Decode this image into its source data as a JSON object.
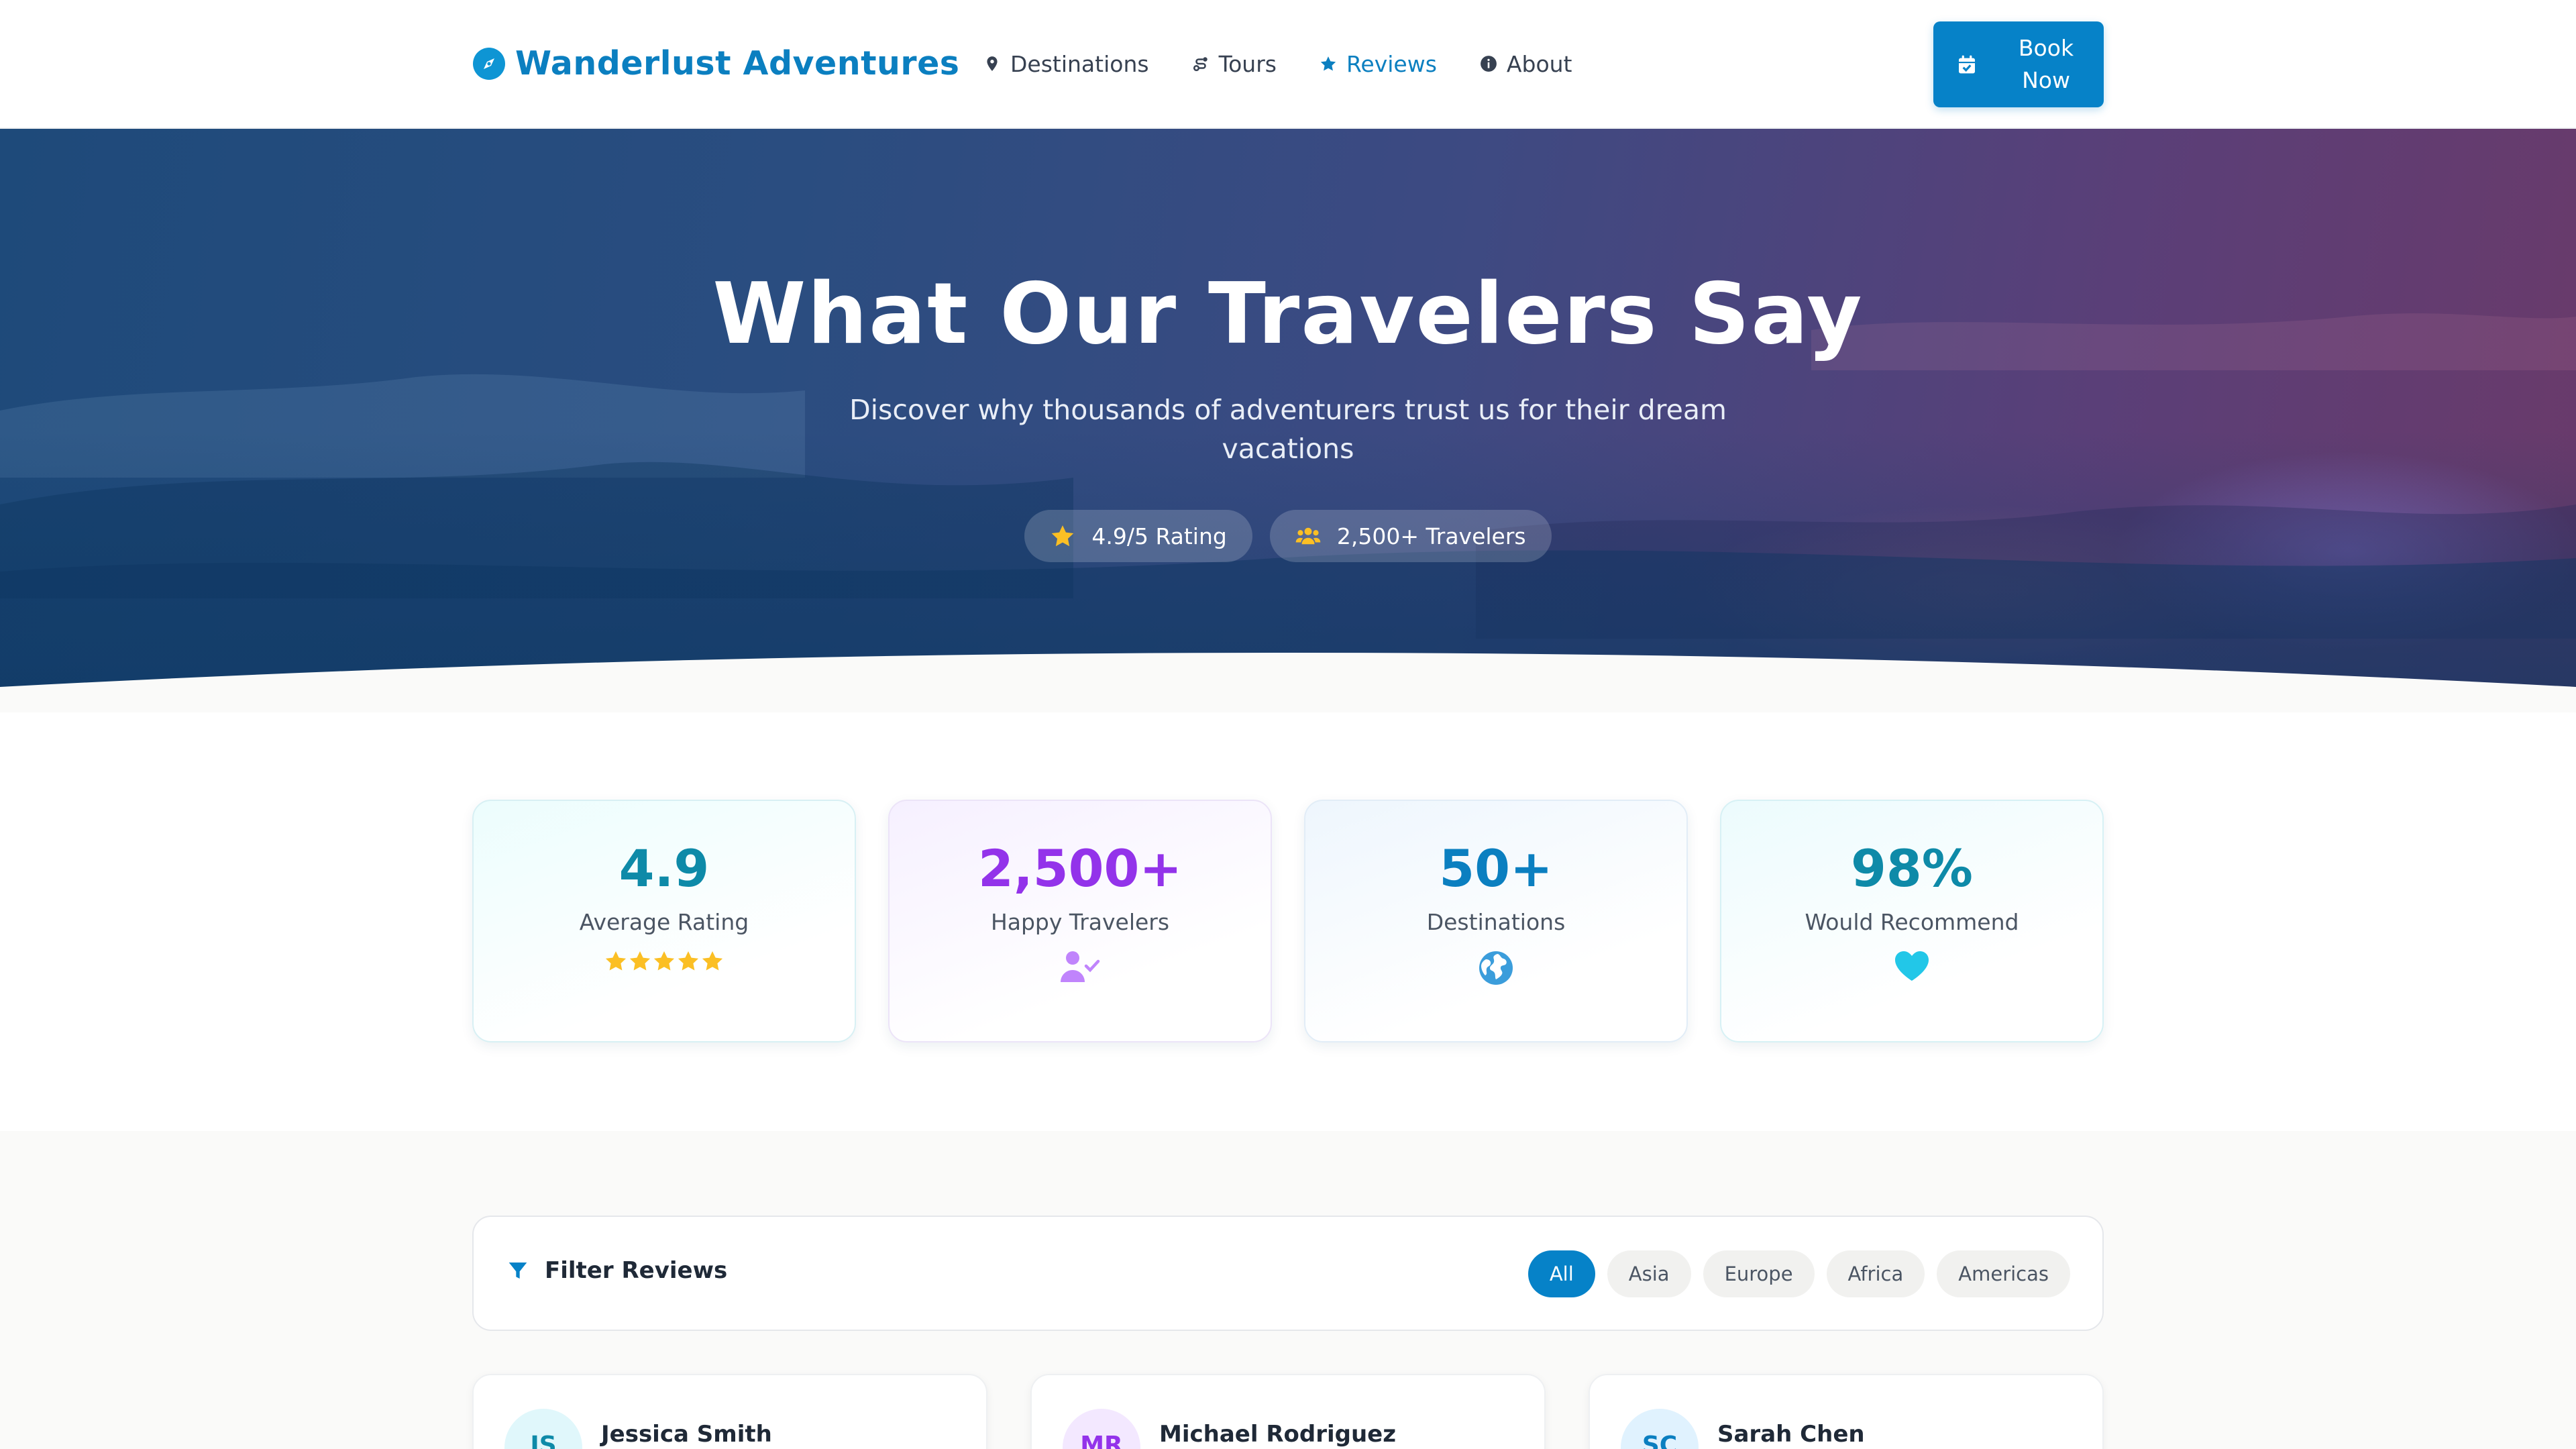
{
  "header": {
    "brand": "Wanderlust Adventures",
    "nav": [
      {
        "label": "Destinations",
        "icon": "map-pin-icon"
      },
      {
        "label": "Tours",
        "icon": "route-icon"
      },
      {
        "label": "Reviews",
        "icon": "star-icon",
        "active": true
      },
      {
        "label": "About",
        "icon": "info-icon"
      }
    ],
    "book_label": "Book Now"
  },
  "hero": {
    "title": "What Our Travelers Say",
    "subtitle": "Discover why thousands of adventurers trust us for their dream vacations",
    "badges": [
      {
        "label": "4.9/5 Rating",
        "icon": "star-icon"
      },
      {
        "label": "2,500+ Travelers",
        "icon": "users-icon"
      }
    ]
  },
  "stats": [
    {
      "value": "4.9",
      "label": "Average Rating",
      "icon": "five-stars-icon",
      "rating": 5
    },
    {
      "value": "2,500+",
      "label": "Happy Travelers",
      "icon": "user-check-icon"
    },
    {
      "value": "50+",
      "label": "Destinations",
      "icon": "globe-icon"
    },
    {
      "value": "98%",
      "label": "Would Recommend",
      "icon": "heart-icon"
    }
  ],
  "filter": {
    "title": "Filter Reviews",
    "options": [
      "All",
      "Asia",
      "Europe",
      "Africa",
      "Americas"
    ],
    "selected": "All"
  },
  "reviews": [
    {
      "initials": "JS",
      "name": "Jessica Smith"
    },
    {
      "initials": "MR",
      "name": "Michael Rodriguez"
    },
    {
      "initials": "SC",
      "name": "Sarah Chen"
    }
  ],
  "colors": {
    "primary": "#0682c8",
    "brand_text": "#0b7fc0",
    "purple": "#9333ea",
    "teal": "#0e8aa8",
    "star": "#fbbf24",
    "heart": "#22c7e8"
  }
}
